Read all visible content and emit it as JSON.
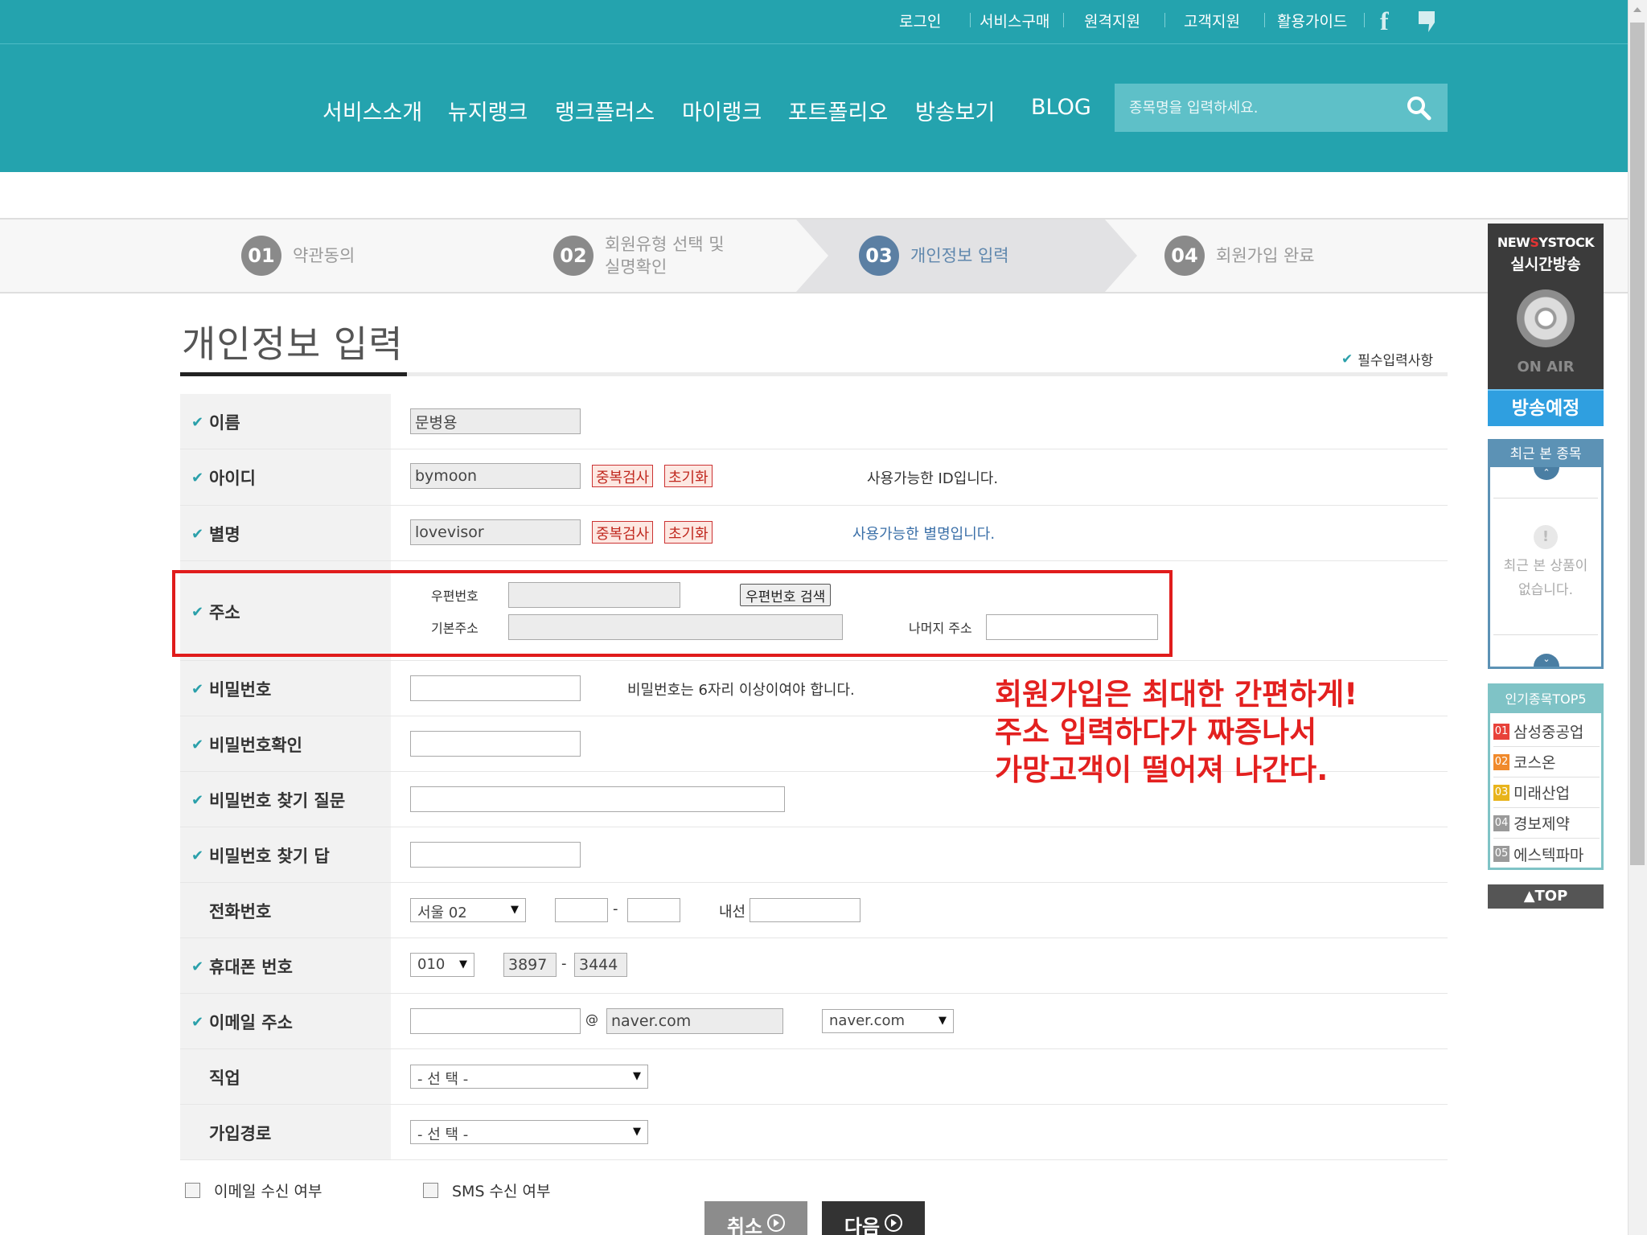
{
  "header": {
    "util_links": [
      "로그인",
      "서비스구매",
      "원격지원",
      "고객지원",
      "활용가이드"
    ],
    "facebook_icon": "facebook-icon",
    "blog_icon": "blog-icon",
    "nav": [
      "서비스소개",
      "뉴지랭크",
      "랭크플러스",
      "마이랭크",
      "포트폴리오",
      "방송보기",
      "BLOG"
    ],
    "search_placeholder": "종목명을 입력하세요.",
    "brand_color": "#24a3ae"
  },
  "steps": [
    {
      "num": "01",
      "label": "약관동의",
      "active": false
    },
    {
      "num": "02",
      "label": "회원유형 선택 및\n실명확인",
      "active": false
    },
    {
      "num": "03",
      "label": "개인정보 입력",
      "active": true
    },
    {
      "num": "04",
      "label": "회원가입 완료",
      "active": false
    }
  ],
  "page_title": "개인정보 입력",
  "required_note": "필수입력사항",
  "form": {
    "name": {
      "label": "이름",
      "value": "문병용"
    },
    "id": {
      "label": "아이디",
      "value": "bymoon",
      "check_btn": "중복검사",
      "reset_btn": "초기화",
      "message": "사용가능한 ID입니다."
    },
    "nickname": {
      "label": "별명",
      "value": "lovevisor",
      "check_btn": "중복검사",
      "reset_btn": "초기화",
      "message": "사용가능한 별명입니다."
    },
    "address": {
      "label": "주소",
      "zip_label": "우편번호",
      "zip_search_btn": "우편번호 검색",
      "base_label": "기본주소",
      "rest_label": "나머지 주소"
    },
    "password": {
      "label": "비밀번호",
      "hint": "비밀번호는 6자리 이상이여야 합니다."
    },
    "password_confirm": {
      "label": "비밀번호확인"
    },
    "pw_question": {
      "label": "비밀번호 찾기 질문"
    },
    "pw_answer": {
      "label": "비밀번호 찾기 답"
    },
    "phone": {
      "label": "전화번호",
      "area": "서울 02",
      "dash": "-",
      "ext_label": "내선"
    },
    "mobile": {
      "label": "휴대폰 번호",
      "prefix": "010",
      "mid": "3897",
      "last": "3444",
      "dash": "-"
    },
    "email": {
      "label": "이메일 주소",
      "at": "@",
      "domain": "naver.com",
      "domain_select": "naver.com"
    },
    "job": {
      "label": "직업",
      "select": "- 선 택 -"
    },
    "join_path": {
      "label": "가입경로",
      "select": "- 선 택 -"
    }
  },
  "consent": {
    "email": "이메일 수신 여부",
    "sms": "SMS 수신 여부"
  },
  "buttons": {
    "cancel": "취소",
    "next": "다음"
  },
  "annotation": [
    "회원가입은 최대한 간편하게!",
    "주소 입력하다가 짜증나서",
    "가망고객이 떨어져 나간다."
  ],
  "sidebar": {
    "onair_brand_prefix": "NEW",
    "onair_brand_s": "S",
    "onair_brand_suffix": "YSTOCK",
    "onair_title": "실시간방송",
    "onair_label": "ON AIR",
    "schedule": "방송예정",
    "recent_title": "최근 본 종목",
    "recent_empty": "최근 본 상품이\n없습니다.",
    "top5_title": "인기종목TOP5",
    "top5": [
      {
        "rank": "01",
        "name": "삼성중공업",
        "color": "#e8423a"
      },
      {
        "rank": "02",
        "name": "코스온",
        "color": "#f08a2c"
      },
      {
        "rank": "03",
        "name": "미래산업",
        "color": "#e8b41c"
      },
      {
        "rank": "04",
        "name": "경보제약",
        "color": "#9a9a9a"
      },
      {
        "rank": "05",
        "name": "에스텍파마",
        "color": "#9a9a9a"
      }
    ],
    "top_btn": "▲TOP"
  }
}
